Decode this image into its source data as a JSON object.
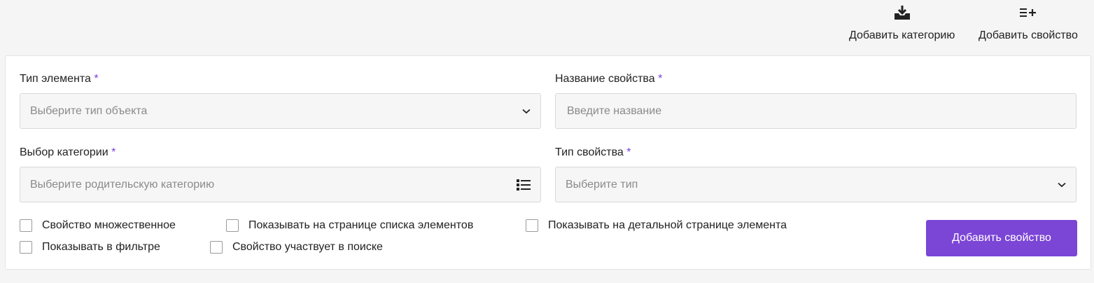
{
  "toolbar": {
    "add_category": {
      "label": "Добавить категорию",
      "icon": "inbox-download-icon"
    },
    "add_property": {
      "label": "Добавить свойство",
      "icon": "list-add-icon"
    }
  },
  "form": {
    "element_type": {
      "label": "Тип элемента",
      "required_mark": "*",
      "placeholder": "Выберите тип объекта"
    },
    "property_name": {
      "label": "Название свойства",
      "required_mark": "*",
      "placeholder": "Введите название"
    },
    "category": {
      "label": "Выбор категории",
      "required_mark": "*",
      "placeholder": "Выберите родительскую категорию"
    },
    "property_type": {
      "label": "Тип свойства",
      "required_mark": "*",
      "placeholder": "Выберите тип"
    }
  },
  "checkboxes": {
    "multiple": "Свойство множественное",
    "show_in_list": "Показывать на странице списка элементов",
    "show_in_detail": "Показывать на детальной странице элемента",
    "show_in_filter": "Показывать в фильтре",
    "in_search": "Свойство участвует в поиске"
  },
  "submit_label": "Добавить свойство",
  "colors": {
    "accent": "#7b45d6",
    "required": "#7b3fdc",
    "field_bg": "#f6f6f6",
    "page_bg": "#f5f5f5"
  }
}
